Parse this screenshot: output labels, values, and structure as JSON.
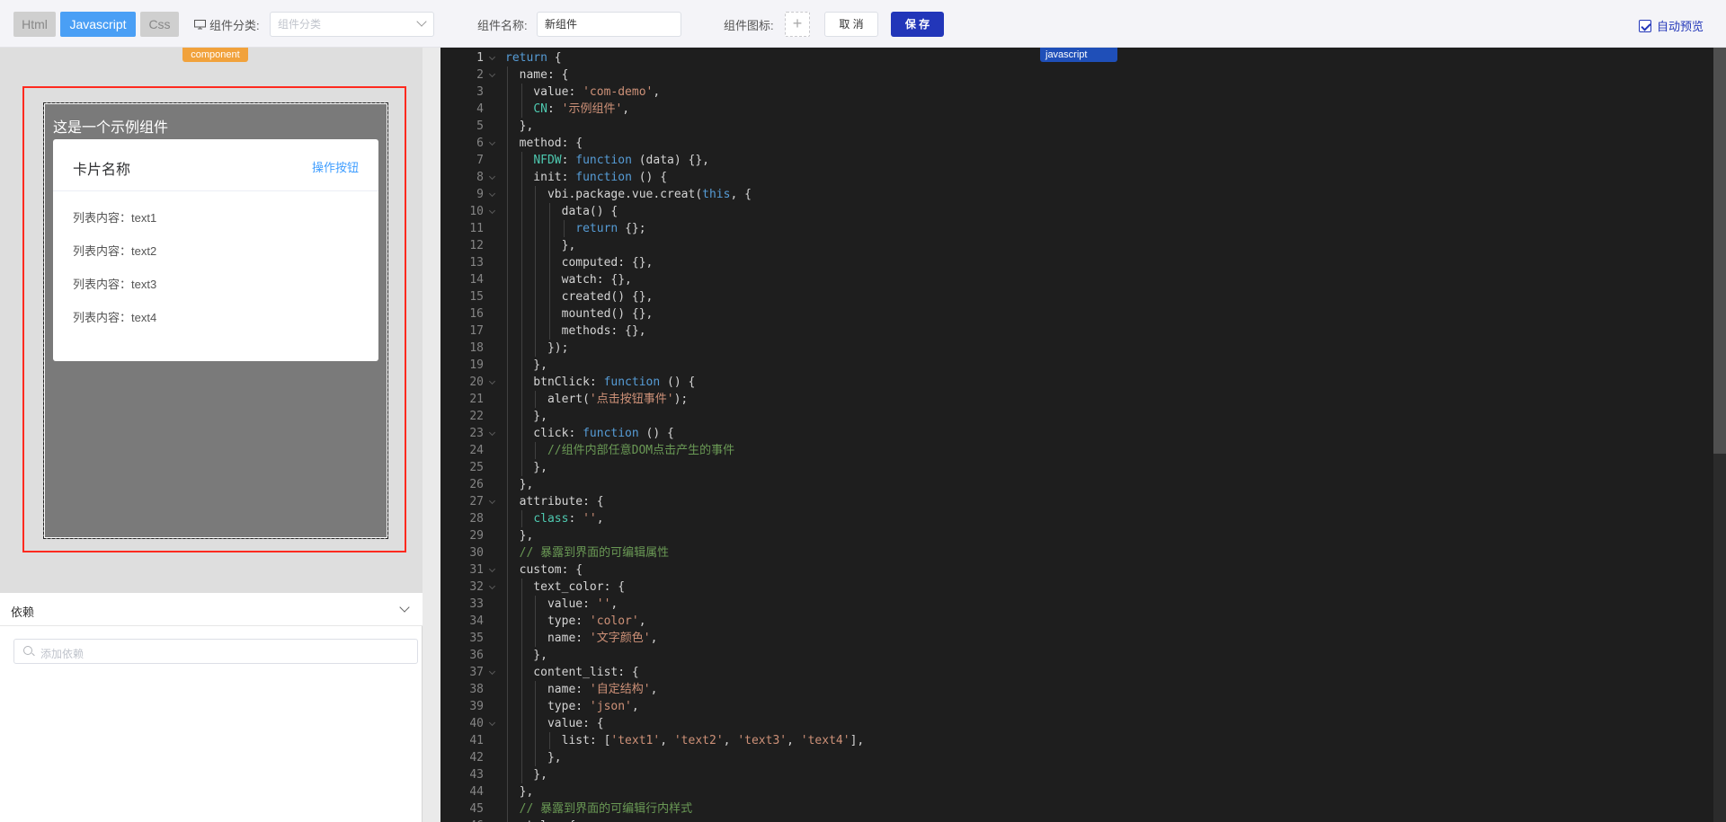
{
  "toolbar": {
    "tabs": [
      "Html",
      "Javascript",
      "Css"
    ],
    "category_label": "组件分类:",
    "category_placeholder": "组件分类",
    "name_label": "组件名称:",
    "name_value": "新组件",
    "icon_label": "组件图标:",
    "icon_add": "+",
    "cancel_label": "取 消",
    "save_label": "保 存",
    "auto_preview_label": "自动预览"
  },
  "preview": {
    "tag": "component",
    "demo_title": "这是一个示例组件",
    "card_name": "卡片名称",
    "card_button": "操作按钮",
    "items": [
      "列表内容：text1",
      "列表内容：text2",
      "列表内容：text3",
      "列表内容：text4"
    ]
  },
  "deps": {
    "title": "依赖",
    "placeholder": "添加依赖"
  },
  "editor": {
    "tag": "javascript",
    "lines": [
      [
        [
          "kw",
          "return"
        ],
        [
          "p",
          " {"
        ]
      ],
      [
        [
          "p",
          "  name: {"
        ]
      ],
      [
        [
          "p",
          "    value: "
        ],
        [
          "str",
          "'com-demo'"
        ],
        [
          "p",
          ","
        ]
      ],
      [
        [
          "p",
          "    "
        ],
        [
          "prop",
          "CN"
        ],
        [
          "p",
          ": "
        ],
        [
          "str",
          "'示例组件'"
        ],
        [
          "p",
          ","
        ]
      ],
      [
        [
          "p",
          "  },"
        ]
      ],
      [
        [
          "p",
          "  method: {"
        ]
      ],
      [
        [
          "p",
          "    "
        ],
        [
          "prop",
          "NFDW"
        ],
        [
          "p",
          ": "
        ],
        [
          "kw",
          "function"
        ],
        [
          "p",
          " (data) {},"
        ]
      ],
      [
        [
          "p",
          "    init: "
        ],
        [
          "kw",
          "function"
        ],
        [
          "p",
          " () {"
        ]
      ],
      [
        [
          "p",
          "      vbi.package.vue.creat("
        ],
        [
          "kw",
          "this"
        ],
        [
          "p",
          ", {"
        ]
      ],
      [
        [
          "p",
          "        data() {"
        ]
      ],
      [
        [
          "p",
          "          "
        ],
        [
          "kw",
          "return"
        ],
        [
          "p",
          " {};"
        ]
      ],
      [
        [
          "p",
          "        },"
        ]
      ],
      [
        [
          "p",
          "        computed: {},"
        ]
      ],
      [
        [
          "p",
          "        watch: {},"
        ]
      ],
      [
        [
          "p",
          "        created() {},"
        ]
      ],
      [
        [
          "p",
          "        mounted() {},"
        ]
      ],
      [
        [
          "p",
          "        methods: {},"
        ]
      ],
      [
        [
          "p",
          "      });"
        ]
      ],
      [
        [
          "p",
          "    },"
        ]
      ],
      [
        [
          "p",
          "    btnClick: "
        ],
        [
          "kw",
          "function"
        ],
        [
          "p",
          " () {"
        ]
      ],
      [
        [
          "p",
          "      alert("
        ],
        [
          "str",
          "'点击按钮事件'"
        ],
        [
          "p",
          ");"
        ]
      ],
      [
        [
          "p",
          "    },"
        ]
      ],
      [
        [
          "p",
          "    click: "
        ],
        [
          "kw",
          "function"
        ],
        [
          "p",
          " () {"
        ]
      ],
      [
        [
          "cm",
          "      //组件内部任意DOM点击产生的事件"
        ]
      ],
      [
        [
          "p",
          "    },"
        ]
      ],
      [
        [
          "p",
          "  },"
        ]
      ],
      [
        [
          "p",
          "  attribute: {"
        ]
      ],
      [
        [
          "p",
          "    "
        ],
        [
          "prop",
          "class"
        ],
        [
          "p",
          ": "
        ],
        [
          "str",
          "''"
        ],
        [
          "p",
          ","
        ]
      ],
      [
        [
          "p",
          "  },"
        ]
      ],
      [
        [
          "cm",
          "  // 暴露到界面的可编辑属性"
        ]
      ],
      [
        [
          "p",
          "  custom: {"
        ]
      ],
      [
        [
          "p",
          "    text_color: {"
        ]
      ],
      [
        [
          "p",
          "      value: "
        ],
        [
          "str",
          "''"
        ],
        [
          "p",
          ","
        ]
      ],
      [
        [
          "p",
          "      type: "
        ],
        [
          "str",
          "'color'"
        ],
        [
          "p",
          ","
        ]
      ],
      [
        [
          "p",
          "      name: "
        ],
        [
          "str",
          "'文字颜色'"
        ],
        [
          "p",
          ","
        ]
      ],
      [
        [
          "p",
          "    },"
        ]
      ],
      [
        [
          "p",
          "    content_list: {"
        ]
      ],
      [
        [
          "p",
          "      name: "
        ],
        [
          "str",
          "'自定结构'"
        ],
        [
          "p",
          ","
        ]
      ],
      [
        [
          "p",
          "      type: "
        ],
        [
          "str",
          "'json'"
        ],
        [
          "p",
          ","
        ]
      ],
      [
        [
          "p",
          "      value: {"
        ]
      ],
      [
        [
          "p",
          "        list: ["
        ],
        [
          "str",
          "'text1'"
        ],
        [
          "p",
          ", "
        ],
        [
          "str",
          "'text2'"
        ],
        [
          "p",
          ", "
        ],
        [
          "str",
          "'text3'"
        ],
        [
          "p",
          ", "
        ],
        [
          "str",
          "'text4'"
        ],
        [
          "p",
          "],"
        ]
      ],
      [
        [
          "p",
          "      },"
        ]
      ],
      [
        [
          "p",
          "    },"
        ]
      ],
      [
        [
          "p",
          "  },"
        ]
      ],
      [
        [
          "cm",
          "  // 暴露到界面的可编辑行内样式"
        ]
      ],
      [
        [
          "p",
          "  style: {"
        ]
      ]
    ],
    "fold_lines": [
      1,
      2,
      6,
      8,
      9,
      10,
      20,
      23,
      27,
      31,
      32,
      37,
      40
    ]
  }
}
